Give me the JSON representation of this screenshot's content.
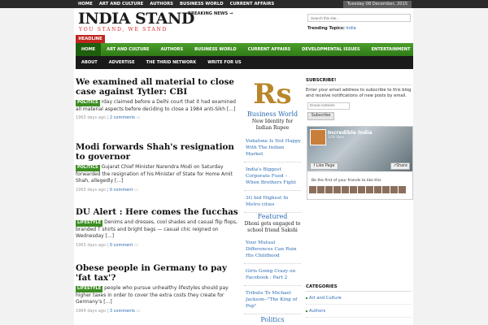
{
  "topnav": [
    "HOME",
    "ART AND CULTURE",
    "AUTHORS",
    "BUSINESS WORLD",
    "CURRENT AFFAIRS"
  ],
  "date": "Tuesday 08 December, 2015",
  "logo": {
    "title": "INDIA STAND",
    "tagline": "YOU STAND, WE STAND"
  },
  "breaking": "BREAKING NEWS →",
  "search": {
    "placeholder": "Search this site..."
  },
  "trending": {
    "label": "Trending Topics:",
    "item": "India"
  },
  "headline_label": "HEADLINE",
  "mainnav": [
    "HOME",
    "ART AND CULTURE",
    "AUTHORS",
    "BUSINESS WORLD",
    "CURRENT AFFAIRS",
    "DEVELOPMENTAL ISSUES",
    "ENTERTAINMENT"
  ],
  "subnav": [
    "ABOUT",
    "ADVERTISE",
    "THE THRID NETWORK",
    "WRITE FOR US"
  ],
  "articles": [
    {
      "title": "We examined all material to close case against Tytler: CBI",
      "tag": "POLITICS",
      "excerpt": "rday claimed before a Delhi court that it had examined all material aspects before deciding to close a 1984 anti-Sikh [...]",
      "age": "1963 days ago",
      "comments": "2 comments"
    },
    {
      "title": "Modi forwards Shah's resignation to governor",
      "tag": "POLITICS",
      "excerpt": "Gujarat Chief Minister Narendra Modi on Saturday forwarded the resignation of his Minister of State for Home Amit Shah, allegedly [...]",
      "age": "1963 days ago",
      "comments": "0 comment"
    },
    {
      "title": "DU Alert : Here comes the fucchas",
      "tag": "LIFESTYLE",
      "excerpt": "Denims and dresses, cool shades and casual flip flops, branded T shirts and bright bags — casual chic reigned on Wednesday [...]",
      "age": "1963 days ago",
      "comments": "0 comment"
    },
    {
      "title": "Obese people in Germany to pay 'fat tax'?",
      "tag": "LIFESTYLE",
      "excerpt": "people who pursue unhealthy lifestyles should pay higher taxes in order to cover the extra costs they create for Germany's [...]",
      "age": "1964 days ago",
      "comments": "3 comments"
    }
  ],
  "middle": {
    "logo_text": "Rs",
    "bw_title": "Business World",
    "bw_sub": "New Identity for Indian Rupee",
    "bw_links": [
      "Vodafone Is Not Happy With The Indian Market",
      "India's Biggest Corporate Fued – When Brothers Fight",
      "3G bid Highest In Metro cities"
    ],
    "featured_title": "Featured",
    "featured_sub": "Dhoni gets engaged to school friend Sakshi",
    "featured_links": [
      "Your Mutual Differences Can Ruin His Childhood",
      "Girls Going Crazy on Facebook : Part 2",
      "Tribute To Michael Jackson--\"The King of Pop\""
    ],
    "politics_title": "Politics"
  },
  "sidebar": {
    "subscribe_title": "SUBSCRIBE!",
    "subscribe_text": "Enter your email address to subscribe to this blog and receive notifications of new posts by email.",
    "email_placeholder": "Email Address",
    "subscribe_btn": "Subscribe",
    "fb_name": "Incredible India",
    "fb_likes": "109 likes",
    "fb_like": "Like Page",
    "fb_share": "Share",
    "fb_friends": "Be the first of your friends to like this",
    "categories_title": "CATEGORIES",
    "categories": [
      "Art and Culture",
      "Authors"
    ]
  },
  "colors": {
    "green": "#3e8e24",
    "red": "#c0261f",
    "link": "#2b6bb3"
  }
}
